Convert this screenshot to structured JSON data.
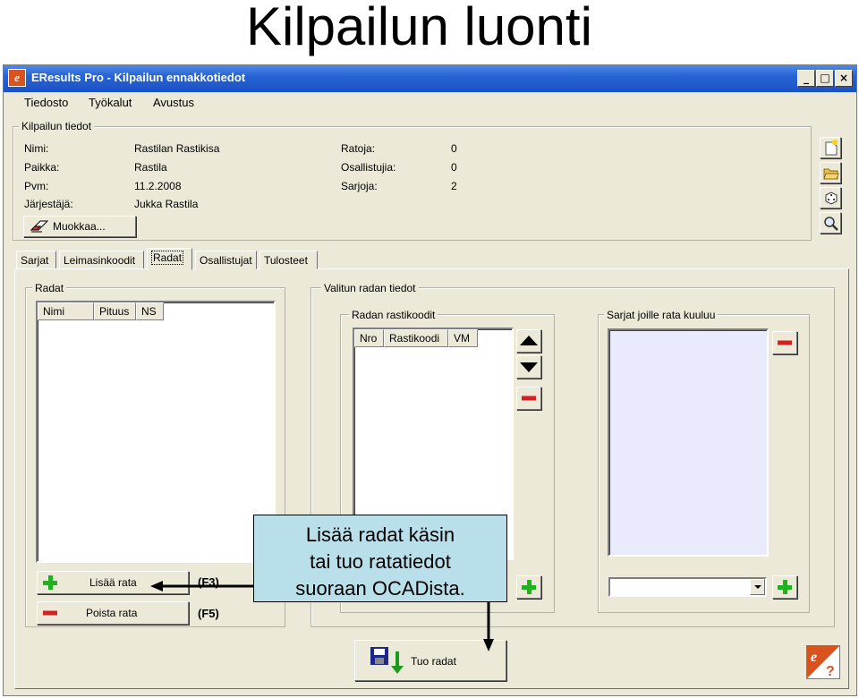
{
  "slide": {
    "title": "Kilpailun luonti"
  },
  "window": {
    "title": "EResults Pro - Kilpailun ennakkotiedot",
    "app_icon": "e",
    "controls": {
      "minimize": "_",
      "maximize": "□",
      "close": "×"
    }
  },
  "menu": [
    {
      "label": "Tiedosto"
    },
    {
      "label": "Työkalut"
    },
    {
      "label": "Avustus"
    }
  ],
  "info": {
    "group_label": "Kilpailun tiedot",
    "name_label": "Nimi:",
    "name_value": "Rastilan Rastikisa",
    "place_label": "Paikka:",
    "place_value": "Rastila",
    "date_label": "Pvm:",
    "date_value": "11.2.2008",
    "organizer_label": "Järjestäjä:",
    "organizer_value": "Jukka Rastila",
    "courses_label": "Ratoja:",
    "courses_value": "0",
    "participants_label": "Osallistujia:",
    "participants_value": "0",
    "classes_label": "Sarjoja:",
    "classes_value": "2",
    "edit_button": "Muokkaa..."
  },
  "side_toolbar": [
    "new-document-icon",
    "open-folder-icon",
    "dice-icon",
    "magnifier-icon"
  ],
  "tabs": [
    {
      "label": "Sarjat",
      "active": false
    },
    {
      "label": "Leimasinkoodit",
      "active": false
    },
    {
      "label": "Radat",
      "active": true
    },
    {
      "label": "Osallistujat",
      "active": false
    },
    {
      "label": "Tulosteet",
      "active": false
    }
  ],
  "courses": {
    "group_label": "Radat",
    "columns": [
      "Nimi",
      "Pituus",
      "NS"
    ],
    "add_button": "Lisää rata",
    "add_shortcut": "(F3)",
    "remove_button": "Poista rata",
    "remove_shortcut": "(F5)"
  },
  "selected_course": {
    "group_label": "Valitun radan tiedot",
    "controls_group_label": "Radan rastikoodit",
    "control_columns": [
      "Nro",
      "Rastikoodi",
      "VM"
    ],
    "classes_group_label": "Sarjat joille rata kuuluu",
    "classes_dropdown_value": ""
  },
  "import_button": "Tuo radat",
  "callout": {
    "line1": "Lisää radat käsin",
    "line2": "tai tuo ratatiedot",
    "line3": "suoraan OCADista."
  },
  "colors": {
    "window_bg": "#ece9d8",
    "titlebar": "#2763d4",
    "callout_bg": "#b9e0ea",
    "plus": "#1fb21f",
    "minus": "#d42020"
  }
}
